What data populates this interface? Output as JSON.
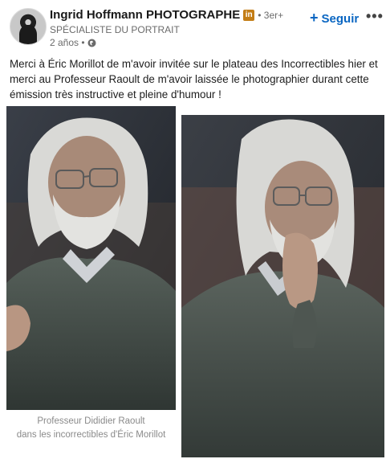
{
  "post": {
    "author_name": "Ingrid Hoffmann PHOTOGRAPHE",
    "badge": "in",
    "degree": "• 3er+",
    "headline": "SPÉCIALISTE DU PORTRAIT",
    "time": "2 años •",
    "follow_label": "Seguir",
    "more_label": "•••",
    "text": "Merci à Éric Morillot de m'avoir invitée sur le plateau des Incorrectibles hier et merci au Professeur Raoult de m'avoir laissée le photographier durant cette émission très instructive et pleine d'humour !"
  },
  "images": {
    "left_caption_line1": "Professeur Dididier Raoult",
    "left_caption_line2": "dans les incorrectibles d'Éric Morillot"
  },
  "icons": {
    "globe": "globe-icon",
    "plus": "plus-icon",
    "more": "more-icon"
  },
  "colors": {
    "accent": "#0a66c2",
    "badge": "#c37d16"
  }
}
